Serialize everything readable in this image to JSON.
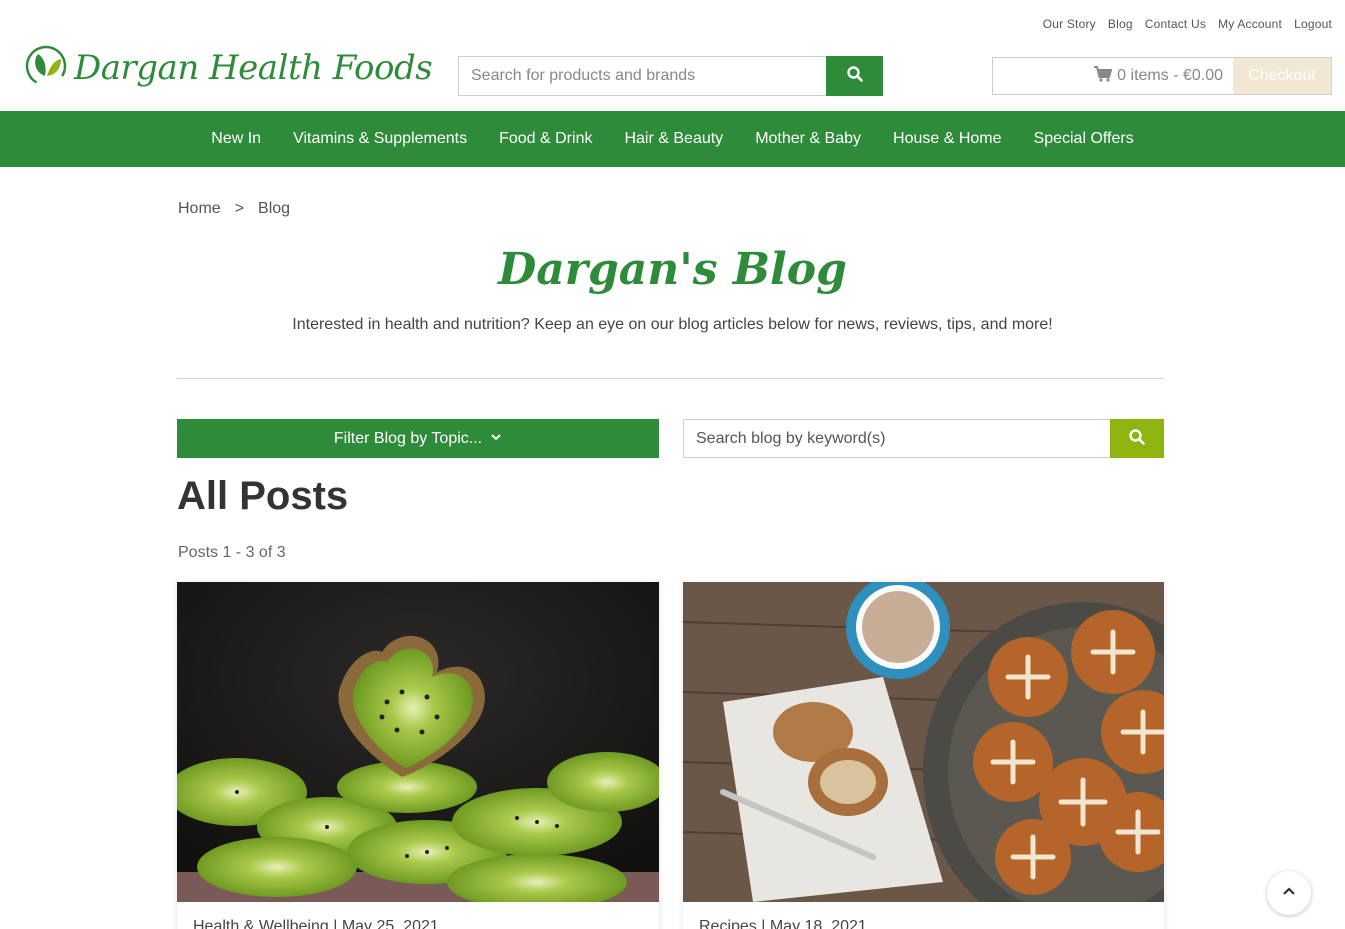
{
  "utility_links": [
    "Our Story",
    "Blog",
    "Contact Us",
    "My Account",
    "Logout"
  ],
  "brand": {
    "name": "Dargan Health Foods",
    "color": "#2e8b3a",
    "logo_icon": "leaf-icon"
  },
  "product_search": {
    "placeholder": "Search for products and brands",
    "icon": "search-icon"
  },
  "cart": {
    "summary": "0 items - €0.00",
    "checkout_label": "Checkout",
    "icon": "cart-icon"
  },
  "nav": [
    "New In",
    "Vitamins & Supplements",
    "Food & Drink",
    "Hair & Beauty",
    "Mother & Baby",
    "House & Home",
    "Special Offers"
  ],
  "breadcrumb": {
    "home": "Home",
    "separator": ">",
    "current": "Blog"
  },
  "blog": {
    "title": "Dargan's Blog",
    "intro": "Interested in health and nutrition? Keep an eye on our blog articles below for news, reviews, tips, and more!",
    "filter_label": "Filter Blog by Topic...",
    "search_placeholder": "Search blog by keyword(s)",
    "section_title": "All Posts",
    "count": "Posts 1 - 3 of 3"
  },
  "posts": [
    {
      "meta": "Health & Wellbeing | May 25, 2021",
      "image": "kiwi-slices-image"
    },
    {
      "meta": "Recipes | May 18, 2021",
      "image": "hot-cross-buns-image"
    }
  ],
  "colors": {
    "primary": "#2e8b3a",
    "accent": "#8fb30f",
    "checkout_bg": "#f1e7d2"
  }
}
